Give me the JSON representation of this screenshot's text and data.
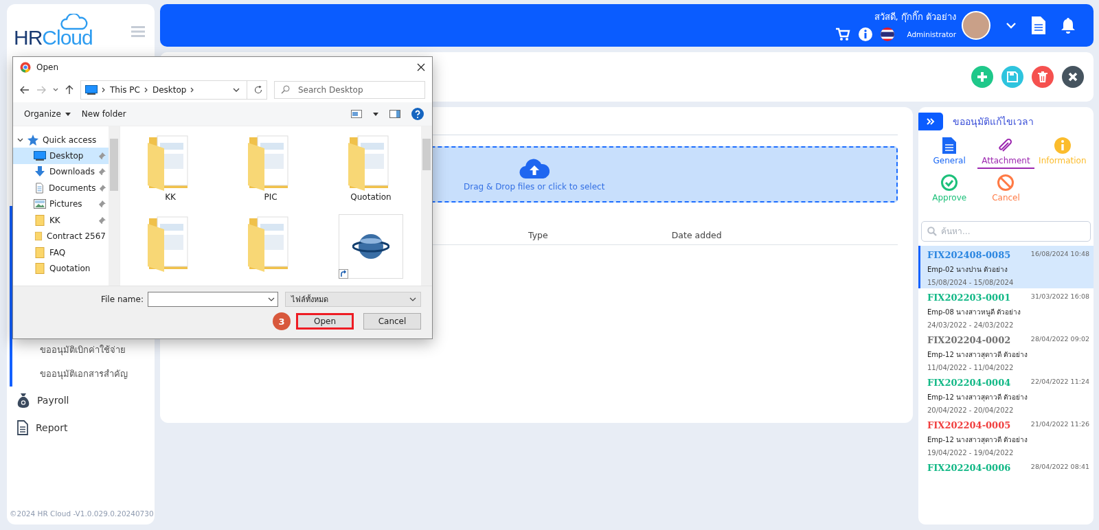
{
  "sidebar": {
    "logo_prefix": "HR",
    "logo_suffix": "Cloud",
    "submenu": [
      {
        "label": "ขออนุมัติเบิกค่าใช้จ่าย"
      },
      {
        "label": "ขออนุมัติเอกสารสำคัญ"
      }
    ],
    "items": [
      {
        "kind": "payroll",
        "label": "Payroll"
      },
      {
        "kind": "report",
        "label": "Report"
      }
    ],
    "footer": "©2024  HR  Cloud  -V1.0.029.0.20240730"
  },
  "header": {
    "greeting": "สวัสดี, กุ๊กกิ๊ก ตัวอย่าง",
    "role": "Administrator"
  },
  "toolbar": {
    "actions": [
      {
        "kind": "add",
        "color": "#1fc88a"
      },
      {
        "kind": "save",
        "color": "#2ec4de"
      },
      {
        "kind": "delete",
        "color": "#f5514f"
      },
      {
        "kind": "close",
        "color": "#46545f"
      }
    ]
  },
  "main": {
    "dropzone": {
      "label": "Drag & Drop files or click to select"
    },
    "table": {
      "columns": [
        "Type",
        "Date added"
      ]
    }
  },
  "panel": {
    "title": "ขออนุมัติแก้ไขเวลา",
    "tabs": [
      {
        "kind": "general",
        "label": "General",
        "color": "#1967f5",
        "selected": false
      },
      {
        "kind": "attachment",
        "label": "Attachment",
        "color": "#9c27b0",
        "selected": true
      },
      {
        "kind": "information",
        "label": "Information",
        "color": "#fbbc2c",
        "selected": false
      },
      {
        "kind": "approve",
        "label": "Approve",
        "color": "#1dc07a",
        "selected": false
      },
      {
        "kind": "cancel",
        "label": "Cancel",
        "color": "#ff7a45",
        "selected": false
      }
    ],
    "search": {
      "placeholder": "ค้นหา..."
    },
    "records": [
      {
        "id": "FIX202408-0085",
        "color": "#2b86e0",
        "timestamp": "16/08/2024 10:48",
        "employee": "Emp-02 นางปาน ตัวอย่าง",
        "period": "15/08/2024 - 15/08/2024",
        "selected": true
      },
      {
        "id": "FIX202203-0001",
        "color": "#12b886",
        "timestamp": "31/03/2022 16:08",
        "employee": "Emp-08 นางสาวหนูดี ตัวอย่าง",
        "period": "24/03/2022 - 24/03/2022",
        "selected": false
      },
      {
        "id": "FIX202204-0002",
        "color": "#707070",
        "timestamp": "28/04/2022 09:02",
        "employee": "Emp-12 นางสาวสุดาวดี ตัวอย่าง",
        "period": "11/04/2022 - 11/04/2022",
        "selected": false
      },
      {
        "id": "FIX202204-0004",
        "color": "#12b886",
        "timestamp": "22/04/2022 11:24",
        "employee": "Emp-12 นางสาวสุดาวดี ตัวอย่าง",
        "period": "20/04/2022 - 20/04/2022",
        "selected": false
      },
      {
        "id": "FIX202204-0005",
        "color": "#f03e3e",
        "timestamp": "21/04/2022 11:26",
        "employee": "Emp-12 นางสาวสุดาวดี ตัวอย่าง",
        "period": "19/04/2022 - 19/04/2022",
        "selected": false
      },
      {
        "id": "FIX202204-0006",
        "color": "#12b886",
        "timestamp": "28/04/2022 08:41",
        "selected": false
      }
    ]
  },
  "dialog": {
    "title": "Open",
    "breadcrumb": [
      "This PC",
      "Desktop"
    ],
    "search_placeholder": "Search Desktop",
    "commands": [
      "Organize",
      "New folder"
    ],
    "nav": [
      {
        "label": "Quick access",
        "kind": "quick",
        "expanded": true,
        "children": [
          {
            "label": "Desktop",
            "kind": "desktop",
            "pinned": true,
            "selected": true
          },
          {
            "label": "Downloads",
            "kind": "downloads",
            "pinned": true,
            "selected": false
          },
          {
            "label": "Documents",
            "kind": "documents",
            "pinned": true,
            "selected": false
          },
          {
            "label": "Pictures",
            "kind": "pictures",
            "pinned": true,
            "selected": false
          },
          {
            "label": "KK",
            "kind": "folder",
            "pinned": true,
            "selected": false
          },
          {
            "label": "Contract 2567",
            "kind": "folder",
            "pinned": false,
            "selected": false
          },
          {
            "label": "FAQ",
            "kind": "folder",
            "pinned": false,
            "selected": false
          },
          {
            "label": "Quotation",
            "kind": "folder",
            "pinned": false,
            "selected": false
          }
        ]
      }
    ],
    "files": [
      {
        "kind": "folder",
        "label": "KK"
      },
      {
        "kind": "folder",
        "label": "PIC"
      },
      {
        "kind": "folder",
        "label": "Quotation"
      },
      {
        "kind": "folder"
      },
      {
        "kind": "folder"
      },
      {
        "kind": "shortcut"
      }
    ],
    "file_name_label": "File name:",
    "file_type": "ไฟล์ทั้งหมด",
    "buttons": [
      {
        "label": "Open",
        "highlighted": true
      },
      {
        "label": "Cancel",
        "highlighted": false
      }
    ],
    "step_badge": "3"
  }
}
